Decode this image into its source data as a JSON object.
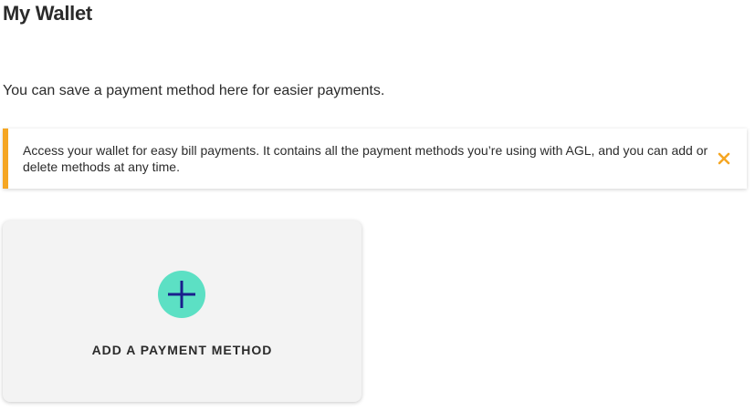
{
  "page": {
    "title": "My Wallet",
    "intro": "You can save a payment method here for easier payments."
  },
  "notice": {
    "text": "Access your wallet for easy bill payments. It contains all the payment methods you’re using with AGL, and you can add or delete methods at any time.",
    "close_icon": "close-icon",
    "accent_color": "#f5a623"
  },
  "add_payment": {
    "label": "ADD A PAYMENT METHOD",
    "icon": "plus-icon",
    "icon_bg_color": "#5ce0c4",
    "icon_fg_color": "#1a1f8c"
  }
}
